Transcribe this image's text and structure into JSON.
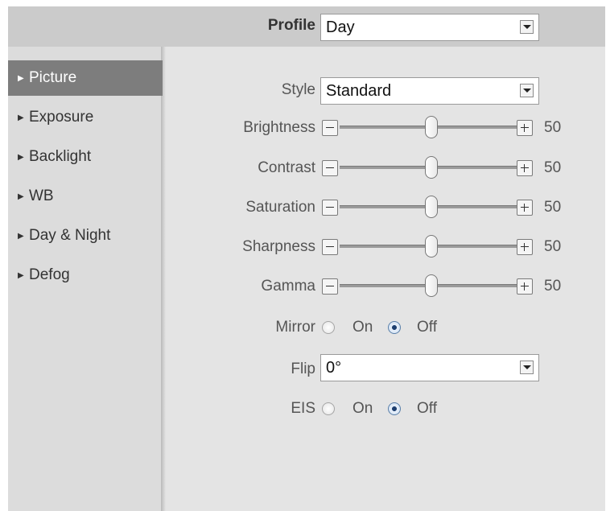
{
  "header": {
    "profile_label": "Profile",
    "profile_value": "Day"
  },
  "sidebar": {
    "items": [
      {
        "label": "Picture",
        "active": true
      },
      {
        "label": "Exposure"
      },
      {
        "label": "Backlight"
      },
      {
        "label": "WB"
      },
      {
        "label": "Day & Night"
      },
      {
        "label": "Defog"
      }
    ]
  },
  "picture": {
    "style": {
      "label": "Style",
      "value": "Standard"
    },
    "sliders": [
      {
        "label": "Brightness",
        "value": 50
      },
      {
        "label": "Contrast",
        "value": 50
      },
      {
        "label": "Saturation",
        "value": 50
      },
      {
        "label": "Sharpness",
        "value": 50
      },
      {
        "label": "Gamma",
        "value": 50
      }
    ],
    "mirror": {
      "label": "Mirror",
      "on_label": "On",
      "off_label": "Off",
      "selected": "Off"
    },
    "flip": {
      "label": "Flip",
      "value": "0°"
    },
    "eis": {
      "label": "EIS",
      "on_label": "On",
      "off_label": "Off",
      "selected": "Off"
    }
  },
  "colors": {
    "header_bg": "#cbcbcb",
    "sidebar_bg": "#dcdcdc",
    "content_bg": "#e4e4e4",
    "active_item_bg": "#7d7d7d",
    "radio_selected": "#1d3f70"
  },
  "icons": [
    "caret-right-icon",
    "dropdown-arrow-icon",
    "minus-icon",
    "plus-icon",
    "radio-button-icon"
  ]
}
